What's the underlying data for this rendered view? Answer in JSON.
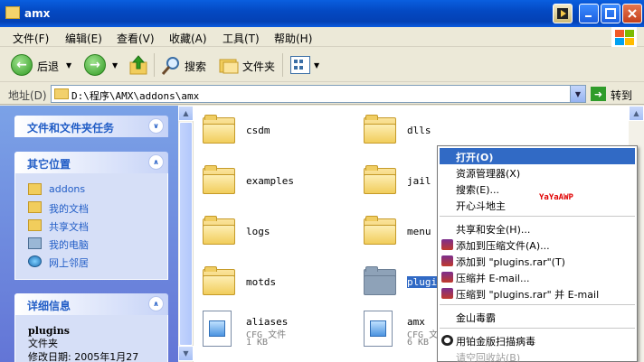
{
  "window": {
    "title": "amx"
  },
  "menubar": {
    "items": [
      "文件(F)",
      "编辑(E)",
      "查看(V)",
      "收藏(A)",
      "工具(T)",
      "帮助(H)"
    ]
  },
  "toolbar": {
    "back_label": "后退",
    "search_label": "搜索",
    "folders_label": "文件夹"
  },
  "address": {
    "label": "地址(D)",
    "path": "D:\\程序\\AMX\\addons\\amx",
    "go_label": "转到"
  },
  "taskpane": {
    "file_tasks_title": "文件和文件夹任务",
    "other_places_title": "其它位置",
    "other_places": [
      "addons",
      "我的文档",
      "共享文档",
      "我的电脑",
      "网上邻居"
    ],
    "details_title": "详细信息",
    "details": {
      "name": "plugins",
      "type": "文件夹",
      "modified": "修改日期: 2005年1月27"
    }
  },
  "files": {
    "folders": [
      "csdm",
      "dlls",
      "examples",
      "jail",
      "logs",
      "menu",
      "motds",
      "plugins"
    ],
    "docs": [
      {
        "name": "aliases",
        "type": "CFG 文件",
        "size": "1 KB"
      },
      {
        "name": "amx",
        "type": "CFG 文",
        "size": "6 KB"
      }
    ]
  },
  "context_menu": {
    "items": [
      "打开(O)",
      "资源管理器(X)",
      "搜索(E)...",
      "开心斗地主",
      "共享和安全(H)...",
      "添加到压缩文件(A)...",
      "添加到 \"plugins.rar\"(T)",
      "压缩并 E-mail...",
      "压缩到 \"plugins.rar\" 并 E-mail",
      "金山毒霸",
      "用铂金版扫描病毒",
      "请空回收站(B)"
    ],
    "watermark": "YaYaAWP"
  }
}
